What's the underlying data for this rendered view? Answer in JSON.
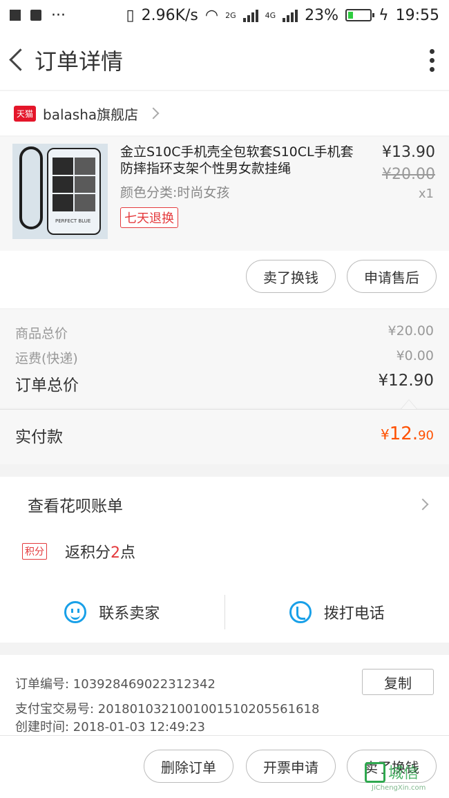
{
  "status_bar": {
    "speed": "2.96K/s",
    "net1": "2G",
    "net2": "4G",
    "battery": "23%",
    "battery_level": 0.23,
    "time": "19:55"
  },
  "header": {
    "title": "订单详情"
  },
  "store": {
    "badge": "天猫",
    "name": "balasha旗舰店"
  },
  "product": {
    "name": "金立S10C手机壳全包软套S10CL手机套防摔指环支架个性男女款挂绳",
    "variant": "颜色分类:时尚女孩",
    "badge": "七天退换",
    "price": "¥13.90",
    "original_price": "¥20.00",
    "qty": "x1",
    "thumb_text": "PERFECT BLUE",
    "buttons": {
      "sell": "卖了换钱",
      "after_sale": "申请售后"
    }
  },
  "summary": {
    "goods_label": "商品总价",
    "goods_value": "¥20.00",
    "shipping_label": "运费(快递)",
    "shipping_value": "¥0.00",
    "total_label": "订单总价",
    "total_value": "¥12.90",
    "paid_label": "实付款",
    "paid_yen": "¥",
    "paid_int": "12.",
    "paid_dec": "90"
  },
  "huabei": {
    "label": "查看花呗账单"
  },
  "points": {
    "badge": "积分",
    "prefix": "返积分",
    "num": "2",
    "suffix": "点"
  },
  "contact": {
    "seller": "联系卖家",
    "call": "拨打电话"
  },
  "order_info": {
    "order_no": "订单编号: 103928469022312342",
    "alipay_no": "支付宝交易号: 2018010321001001510205561618",
    "created": "创建时间: 2018-01-03 12:49:23",
    "copy": "复制"
  },
  "bottom_buttons": {
    "delete": "删除订单",
    "invoice": "开票申请",
    "sell": "卖了换钱"
  },
  "watermark": {
    "cn": "城信",
    "en": "JiChengXin.com"
  },
  "colors": {
    "accent_blue": "#19a0e8",
    "price_orange": "#ff5000",
    "tmall_red": "#e4162a"
  }
}
